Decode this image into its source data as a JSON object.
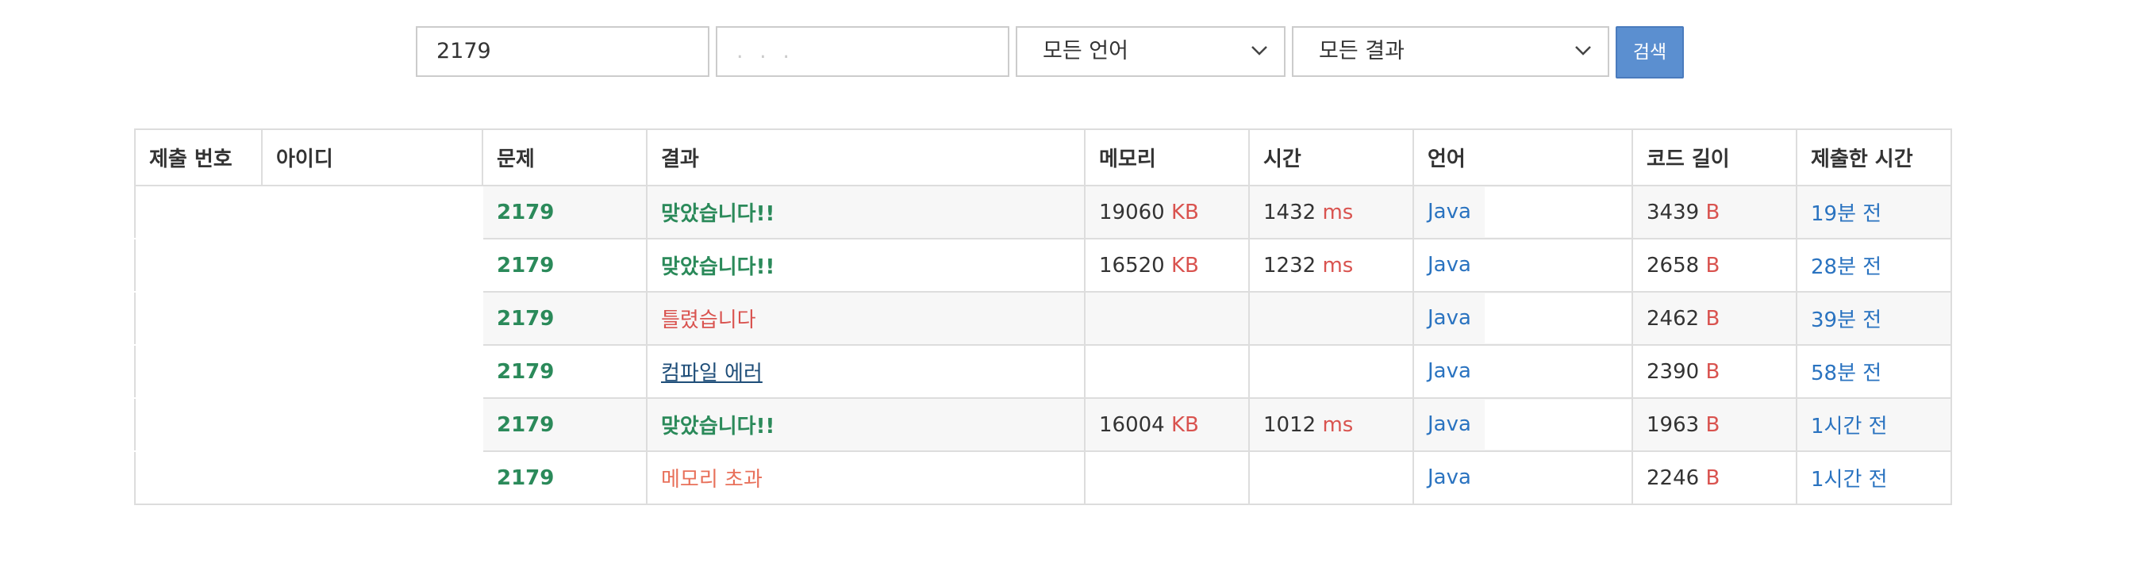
{
  "filters": {
    "problem_id": "2179",
    "user_id_masked": ". . .",
    "language_select": "모든 언어",
    "result_select": "모든 결과",
    "search_button": "검색"
  },
  "table": {
    "headers": [
      "제출 번호",
      "아이디",
      "문제",
      "결과",
      "메모리",
      "시간",
      "언어",
      "코드 길이",
      "제출한 시간"
    ],
    "rows": [
      {
        "problem": "2179",
        "result": "맞았습니다!!",
        "result_class": "ac",
        "memory": "19060",
        "memory_unit": "KB",
        "time": "1432",
        "time_unit": "ms",
        "language": "Java",
        "code_length": "3439",
        "code_unit": "B",
        "submitted": "19분 전"
      },
      {
        "problem": "2179",
        "result": "맞았습니다!!",
        "result_class": "ac",
        "memory": "16520",
        "memory_unit": "KB",
        "time": "1232",
        "time_unit": "ms",
        "language": "Java",
        "code_length": "2658",
        "code_unit": "B",
        "submitted": "28분 전"
      },
      {
        "problem": "2179",
        "result": "틀렸습니다",
        "result_class": "wa",
        "memory": "",
        "memory_unit": "",
        "time": "",
        "time_unit": "",
        "language": "Java",
        "code_length": "2462",
        "code_unit": "B",
        "submitted": "39분 전"
      },
      {
        "problem": "2179",
        "result": "컴파일 에러",
        "result_class": "ce",
        "memory": "",
        "memory_unit": "",
        "time": "",
        "time_unit": "",
        "language": "Java",
        "code_length": "2390",
        "code_unit": "B",
        "submitted": "58분 전"
      },
      {
        "problem": "2179",
        "result": "맞았습니다!!",
        "result_class": "ac",
        "memory": "16004",
        "memory_unit": "KB",
        "time": "1012",
        "time_unit": "ms",
        "language": "Java",
        "code_length": "1963",
        "code_unit": "B",
        "submitted": "1시간 전"
      },
      {
        "problem": "2179",
        "result": "메모리 초과",
        "result_class": "mle",
        "memory": "",
        "memory_unit": "",
        "time": "",
        "time_unit": "",
        "language": "Java",
        "code_length": "2246",
        "code_unit": "B",
        "submitted": "1시간 전"
      }
    ]
  },
  "colors": {
    "accepted": "#2b8a5a",
    "wrong": "#d9534f",
    "compile_error": "#1f4e79",
    "memory_exceeded": "#e8705a",
    "link": "#2a73c0",
    "button": "#5b8fd0"
  }
}
